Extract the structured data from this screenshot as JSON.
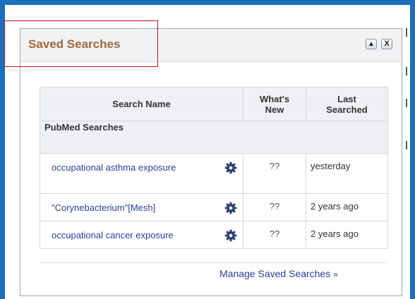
{
  "panel": {
    "title": "Saved Searches",
    "collapse_glyph": "▲",
    "close_glyph": "X"
  },
  "table": {
    "headers": {
      "name": "Search Name",
      "whats_new_line1": "What's",
      "whats_new_line2": "New",
      "last_line1": "Last",
      "last_line2": "Searched"
    },
    "group": "PubMed Searches",
    "rows": [
      {
        "name": "occupational asthma exposure",
        "whats_new": "??",
        "last_searched": "yesterday"
      },
      {
        "name": "\"Corynebacterium\"[Mesh]",
        "whats_new": "??",
        "last_searched": "2 years ago"
      },
      {
        "name": "occupational cancer exposure",
        "whats_new": "??",
        "last_searched": "2 years ago"
      }
    ]
  },
  "footer": {
    "manage_label": "Manage Saved Searches",
    "manage_suffix": "»"
  },
  "icons": {
    "gear": "gear-icon",
    "collapse": "collapse-icon",
    "close": "close-icon"
  },
  "colors": {
    "frame_border": "#1b6fbd",
    "title": "#a0693a",
    "link": "#2a3f9e",
    "highlight": "#c0121b"
  }
}
